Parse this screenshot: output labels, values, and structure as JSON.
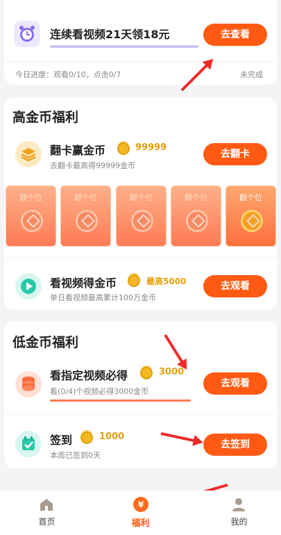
{
  "streak": {
    "title": "连续看视频21天领18元",
    "button": "去查看",
    "progress_text": "今日进度：观看0/10，点击0/7",
    "status": "未完成"
  },
  "high": {
    "section_title": "高金币福利",
    "flip": {
      "title": "翻卡赢金币",
      "coins": "99999",
      "subtitle": "去翻卡最高得99999金币",
      "button": "去翻卡",
      "cards": [
        "翻个位",
        "翻个位",
        "翻个位",
        "翻个位",
        "翻个位"
      ]
    },
    "video": {
      "title": "看视频得金币",
      "coins": "最高5000",
      "subtitle": "单日看视频最高累计100万金币",
      "button": "去观看"
    }
  },
  "low": {
    "section_title": "低金币福利",
    "watch": {
      "title": "看指定视频必得",
      "coins": "3000",
      "subtitle": "看(0/4)个视频必得3000金币",
      "button": "去观看"
    },
    "signin": {
      "title": "签到",
      "coins": "1000",
      "subtitle": "本周已签到0天",
      "button": "去签到"
    }
  },
  "tabbar": {
    "tabs": [
      {
        "label": "首页",
        "icon": "house-icon"
      },
      {
        "label": "福利",
        "icon": "yen-coin-icon",
        "active": true
      },
      {
        "label": "我的",
        "icon": "person-icon"
      }
    ],
    "active_color": "#ff5a14"
  },
  "colors": {
    "accent": "#ff5a14",
    "coin": "#e6a00e",
    "annotation": "#ee2a2a"
  }
}
